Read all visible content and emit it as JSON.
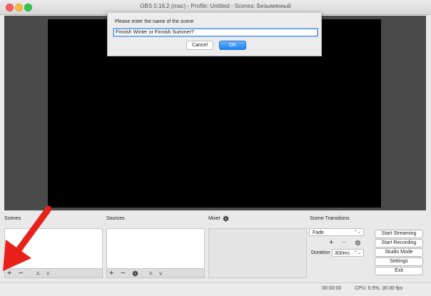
{
  "window": {
    "title": "OBS 0.16.2 (mac) - Profile: Untitled - Scenes: Безымянный"
  },
  "dialog": {
    "prompt": "Please enter the name of the scene",
    "input_value": "Finnish Winter or Finnish Summer?",
    "cancel_label": "Cancel",
    "ok_label": "OK"
  },
  "docks": {
    "scenes_label": "Scenes",
    "sources_label": "Sources",
    "mixer_label": "Mixer",
    "transitions_label": "Scene Transitions"
  },
  "transitions": {
    "selected": "Fade",
    "duration_label": "Duration",
    "duration_value": "300ms"
  },
  "controls": {
    "start_streaming": "Start Streaming",
    "start_recording": "Start Recording",
    "studio_mode": "Studio Mode",
    "settings": "Settings",
    "exit": "Exit"
  },
  "status": {
    "time": "00:00:00",
    "cpu": "CPU: 0.5%, 30.00 fps"
  },
  "colors": {
    "traffic_close": "#fc605c",
    "traffic_min": "#fdbc40",
    "traffic_max": "#34c84a",
    "annotation_arrow": "#e8221b",
    "ok_button": "#1a82fb"
  },
  "icons": {
    "add": "plus-icon",
    "remove": "minus-icon",
    "move_up": "chevron-up-icon",
    "move_down": "chevron-down-icon",
    "properties": "gear-icon"
  }
}
